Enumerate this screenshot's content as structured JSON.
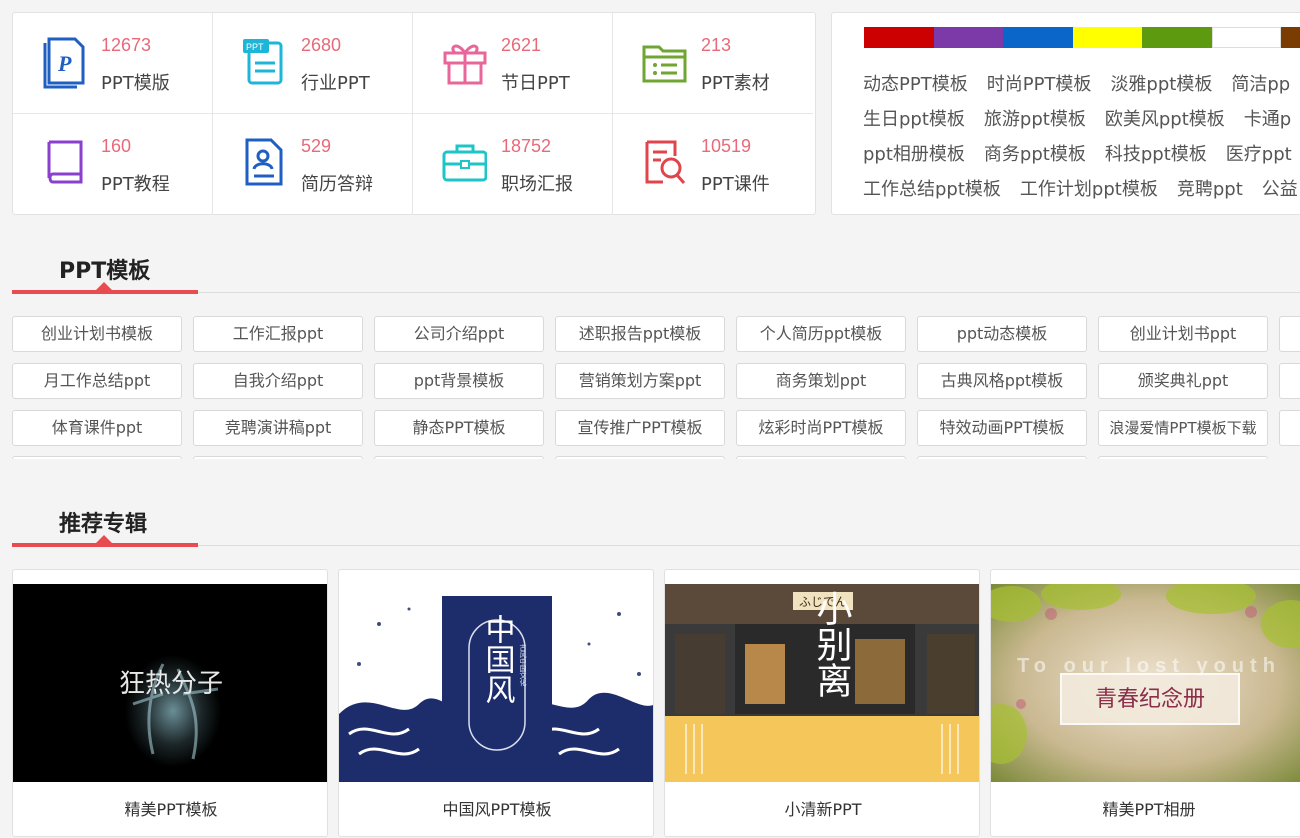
{
  "categories": [
    {
      "count": "12673",
      "label": "PPT模版",
      "icon": "ppt-file-icon",
      "color": "#1f5fc1"
    },
    {
      "count": "2680",
      "label": "行业PPT",
      "icon": "ppt-document-icon",
      "color": "#1eb6d8"
    },
    {
      "count": "2621",
      "label": "节日PPT",
      "icon": "gift-icon",
      "color": "#e8669a"
    },
    {
      "count": "213",
      "label": "PPT素材",
      "icon": "folder-list-icon",
      "color": "#6fa531"
    },
    {
      "count": "160",
      "label": "PPT教程",
      "icon": "book-icon",
      "color": "#8a3fcf"
    },
    {
      "count": "529",
      "label": "简历答辩",
      "icon": "resume-icon",
      "color": "#1f5fc1"
    },
    {
      "count": "18752",
      "label": "职场汇报",
      "icon": "briefcase-icon",
      "color": "#1ec5c8"
    },
    {
      "count": "10519",
      "label": "PPT课件",
      "icon": "search-document-icon",
      "color": "#e0454b"
    }
  ],
  "colors": [
    "#cc0000",
    "#7b3aa8",
    "#0a66c8",
    "#ffff00",
    "#5e9a0f",
    "#ffffff",
    "#7a3c00"
  ],
  "tags": [
    [
      "动态PPT模板",
      "时尚PPT模板",
      "淡雅ppt模板",
      "简洁pp"
    ],
    [
      "生日ppt模板",
      "旅游ppt模板",
      "欧美风ppt模板",
      "卡通p"
    ],
    [
      "ppt相册模板",
      "商务ppt模板",
      "科技ppt模板",
      "医疗ppt"
    ],
    [
      "工作总结ppt模板",
      "工作计划ppt模板",
      "竞聘ppt",
      "公益"
    ]
  ],
  "sections": {
    "templates_title": "PPT模板",
    "albums_title": "推荐专辑"
  },
  "keywords": [
    [
      "创业计划书模板",
      "工作汇报ppt",
      "公司介绍ppt",
      "述职报告ppt模板",
      "个人简历ppt模板",
      "ppt动态模板",
      "创业计划书ppt"
    ],
    [
      "月工作总结ppt",
      "自我介绍ppt",
      "ppt背景模板",
      "营销策划方案ppt",
      "商务策划ppt",
      "古典风格ppt模板",
      "颁奖典礼ppt"
    ],
    [
      "体育课件ppt",
      "竞聘演讲稿ppt",
      "静态PPT模板",
      "宣传推广PPT模板",
      "炫彩时尚PPT模板",
      "特效动画PPT模板",
      "浪漫爱情PPT模板下载"
    ]
  ],
  "albums": [
    {
      "caption": "精美PPT模板",
      "thumb_text": "狂热分子"
    },
    {
      "caption": "中国风PPT模板",
      "thumb_text": "中国风",
      "thumb_sub": "古风中国文化"
    },
    {
      "caption": "小清新PPT",
      "thumb_text": "小别离",
      "thumb_sign": "ふじでん"
    },
    {
      "caption": "精美PPT相册",
      "thumb_text": "青春纪念册",
      "thumb_sub": "To our lost youth"
    }
  ]
}
